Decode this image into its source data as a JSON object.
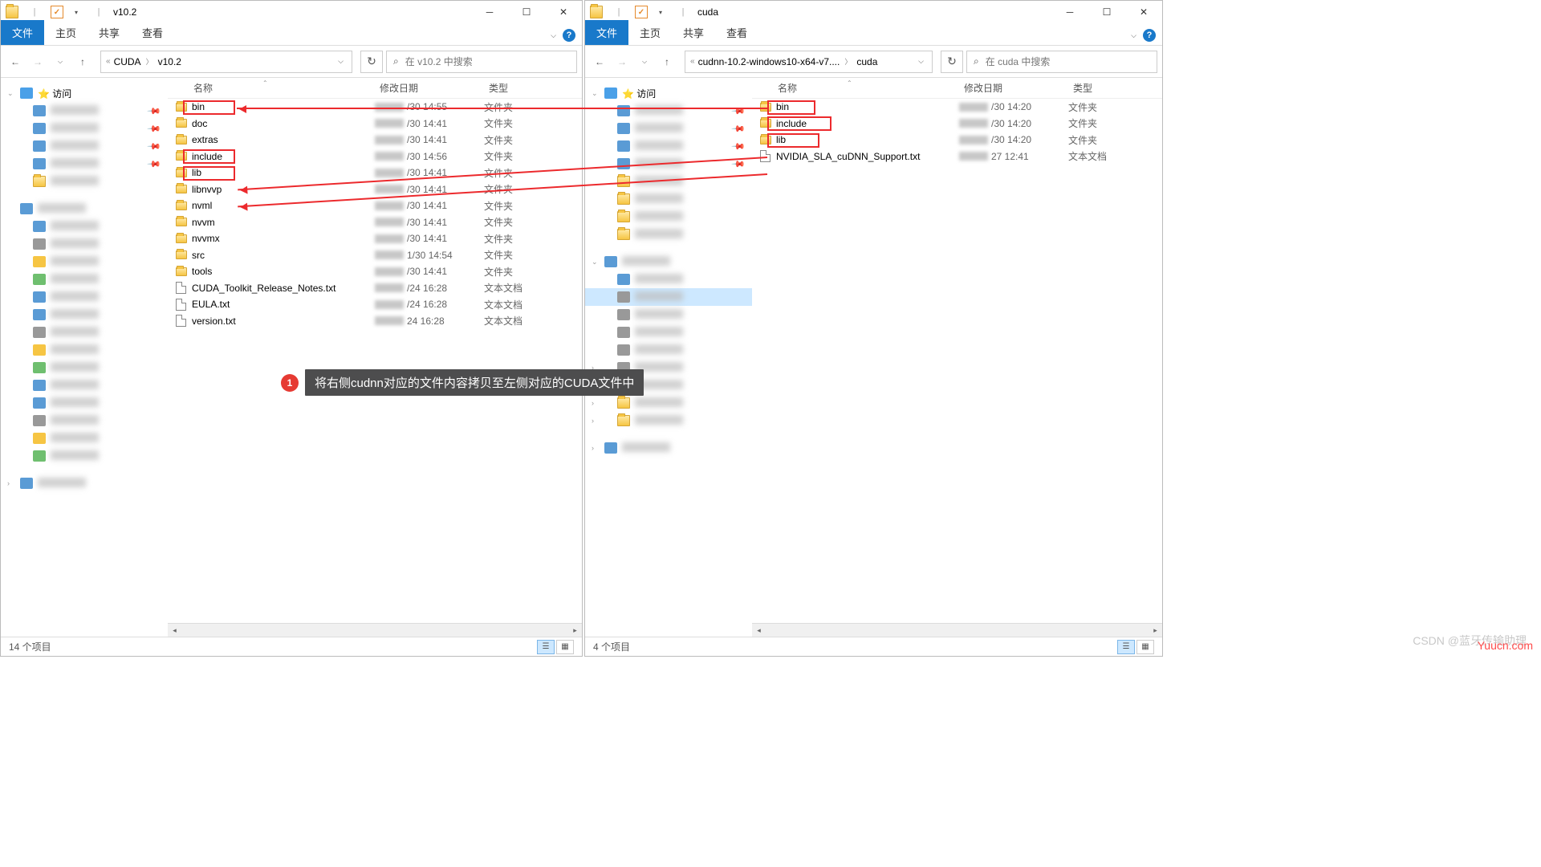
{
  "left": {
    "title": "v10.2",
    "ribbon": {
      "file": "文件",
      "home": "主页",
      "share": "共享",
      "view": "查看"
    },
    "crumb": {
      "seg1": "CUDA",
      "seg2": "v10.2"
    },
    "search_placeholder": "在 v10.2 中搜索",
    "headers": {
      "name": "名称",
      "date": "修改日期",
      "type": "类型"
    },
    "rows": [
      {
        "name": "bin",
        "date": "/30 14:55",
        "type": "文件夹",
        "folder": true,
        "hl": true
      },
      {
        "name": "doc",
        "date": "/30 14:41",
        "type": "文件夹",
        "folder": true
      },
      {
        "name": "extras",
        "date": "/30 14:41",
        "type": "文件夹",
        "folder": true
      },
      {
        "name": "include",
        "date": "/30 14:56",
        "type": "文件夹",
        "folder": true,
        "hl": true
      },
      {
        "name": "lib",
        "date": "/30 14:41",
        "type": "文件夹",
        "folder": true,
        "hl": true
      },
      {
        "name": "libnvvp",
        "date": "/30 14:41",
        "type": "文件夹",
        "folder": true
      },
      {
        "name": "nvml",
        "date": "/30 14:41",
        "type": "文件夹",
        "folder": true
      },
      {
        "name": "nvvm",
        "date": "/30 14:41",
        "type": "文件夹",
        "folder": true
      },
      {
        "name": "nvvmx",
        "date": "/30 14:41",
        "type": "文件夹",
        "folder": true
      },
      {
        "name": "src",
        "date": "1/30 14:54",
        "type": "文件夹",
        "folder": true
      },
      {
        "name": "tools",
        "date": "/30 14:41",
        "type": "文件夹",
        "folder": true
      },
      {
        "name": "CUDA_Toolkit_Release_Notes.txt",
        "date": "/24 16:28",
        "type": "文本文档",
        "folder": false
      },
      {
        "name": "EULA.txt",
        "date": "/24 16:28",
        "type": "文本文档",
        "folder": false
      },
      {
        "name": "version.txt",
        "date": "24 16:28",
        "type": "文本文档",
        "folder": false
      }
    ],
    "status": "14 个项目",
    "nav_quick": "访问"
  },
  "right": {
    "title": "cuda",
    "ribbon": {
      "file": "文件",
      "home": "主页",
      "share": "共享",
      "view": "查看"
    },
    "crumb": {
      "seg1": "cudnn-10.2-windows10-x64-v7....",
      "seg2": "cuda"
    },
    "search_placeholder": "在 cuda 中搜索",
    "headers": {
      "name": "名称",
      "date": "修改日期",
      "type": "类型"
    },
    "rows": [
      {
        "name": "bin",
        "date": "/30 14:20",
        "type": "文件夹",
        "folder": true,
        "hl": true
      },
      {
        "name": "include",
        "date": "/30 14:20",
        "type": "文件夹",
        "folder": true,
        "hl": true
      },
      {
        "name": "lib",
        "date": "/30 14:20",
        "type": "文件夹",
        "folder": true,
        "hl": true
      },
      {
        "name": "NVIDIA_SLA_cuDNN_Support.txt",
        "date": "27 12:41",
        "type": "文本文档",
        "folder": false
      }
    ],
    "status": "4 个项目",
    "nav_quick": "访问"
  },
  "annotation": {
    "num": "1",
    "text": "将右侧cudnn对应的文件内容拷贝至左侧对应的CUDA文件中"
  },
  "watermark": "Yuucn.com",
  "csdn": "CSDN @蓝牙传输助理"
}
